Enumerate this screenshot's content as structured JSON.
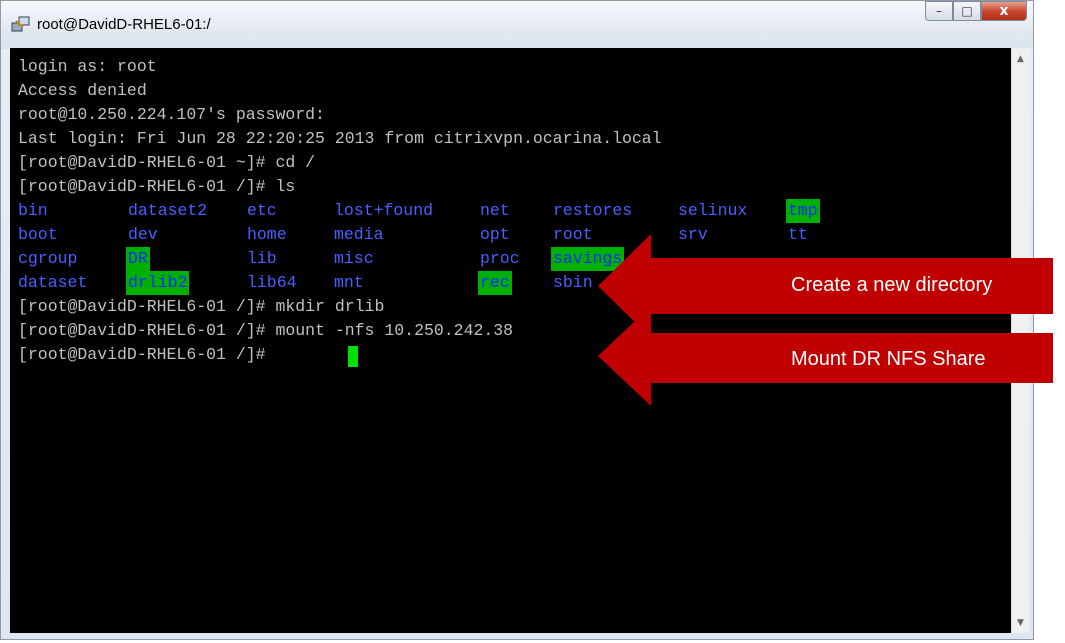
{
  "window": {
    "title": "root@DavidD-RHEL6-01:/",
    "controls": [
      "minimize",
      "maximize",
      "close"
    ],
    "close_glyph": "x",
    "minimize_glyph": "–",
    "maximize_glyph": "□"
  },
  "terminal": {
    "lines": [
      "login as: root",
      "Access denied",
      "root@10.250.224.107's password:",
      "Last login: Fri Jun 28 22:20:25 2013 from citrixvpn.ocarina.local",
      "[root@DavidD-RHEL6-01 ~]# cd /",
      "[root@DavidD-RHEL6-01 /]# ls"
    ],
    "ls_rows": [
      [
        "bin",
        "dataset2",
        "etc",
        "lost+found",
        "net",
        "restores",
        "selinux",
        "tmp"
      ],
      [
        "boot",
        "dev",
        "home",
        "media",
        "opt",
        "root",
        "srv",
        "tt"
      ],
      [
        "cgroup",
        "DR",
        "lib",
        "misc",
        "proc",
        "savings",
        "",
        ""
      ],
      [
        "dataset",
        "drlib2",
        "lib64",
        "mnt",
        "rec",
        "sbin",
        "",
        ""
      ]
    ],
    "after_lines": [
      "[root@DavidD-RHEL6-01 /]# mkdir drlib",
      "[root@DavidD-RHEL6-01 /]# mount -nfs 10.250.242.38",
      "[root@DavidD-RHEL6-01 /]# "
    ]
  },
  "callouts": {
    "mkdir": "Create a new directory",
    "mount": "Mount DR NFS Share"
  },
  "colors": {
    "terminal_bg": "#000000",
    "terminal_text": "#c0c0c0",
    "dir_text": "#4a5fff",
    "highlight": "#00b000",
    "callout": "#c00000"
  }
}
